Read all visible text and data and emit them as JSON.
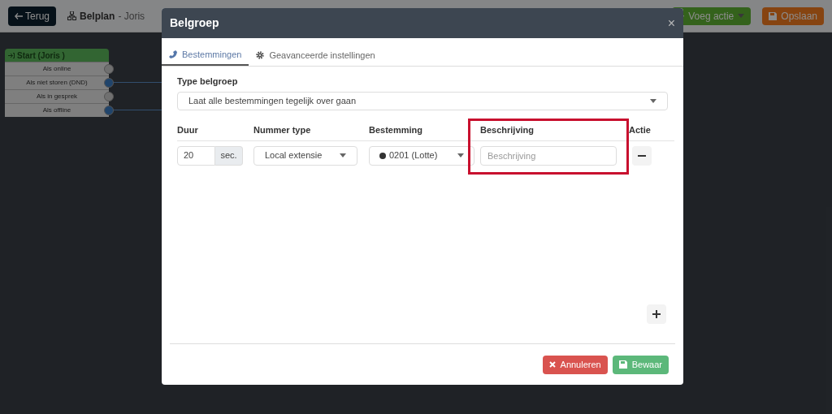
{
  "topbar": {
    "back_button": "Terug",
    "title": "Belplan",
    "subtitle": "- Joris",
    "add_button": "Voeg actie",
    "save_button": "Opslaan"
  },
  "node": {
    "title": "Start (Joris )",
    "outputs": [
      {
        "label": "Als online",
        "connected": false
      },
      {
        "label": "Als niet storen (DND)",
        "connected": true
      },
      {
        "label": "Als in gesprek",
        "connected": false
      },
      {
        "label": "Als offline",
        "connected": true
      }
    ]
  },
  "modal": {
    "title": "Belgroep",
    "close": "×",
    "tabs": [
      {
        "label": "Bestemmingen",
        "selected": true
      },
      {
        "label": "Geavanceerde instellingen",
        "selected": false
      }
    ],
    "type_label": "Type belgroep",
    "type_value": "Laat alle bestemmingen tegelijk over gaan",
    "columns": [
      {
        "label": "Duur",
        "highlighted": false
      },
      {
        "label": "Nummer type",
        "highlighted": false
      },
      {
        "label": "Bestemming",
        "highlighted": false
      },
      {
        "label": "Beschrijving",
        "highlighted": true
      },
      {
        "label": "Actie",
        "highlighted": false
      }
    ],
    "rows": [
      {
        "duration": "20",
        "unit": "sec.",
        "number_type": "Local extensie",
        "destination": "0201 (Lotte)",
        "description_placeholder": "Beschrijving"
      }
    ],
    "cancel_button": "Annuleren",
    "save_button": "Bewaar"
  }
}
